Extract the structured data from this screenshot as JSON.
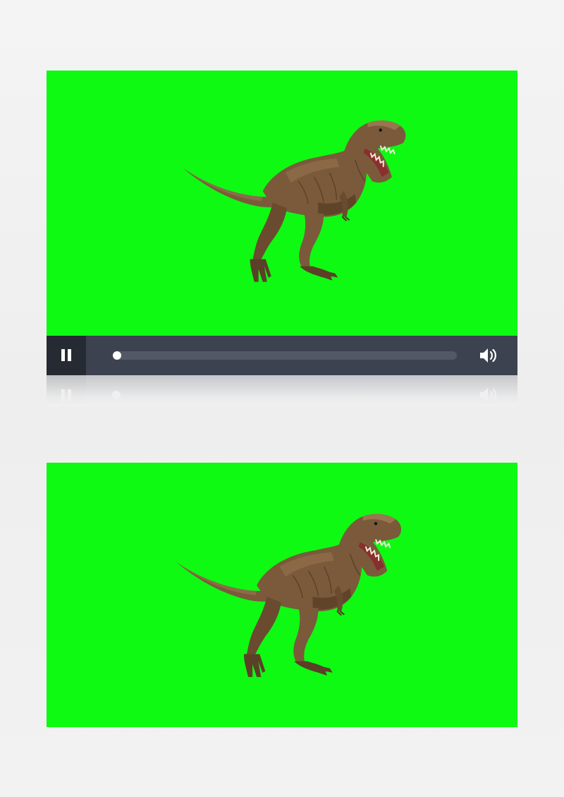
{
  "colors": {
    "green_screen": "#0efa12",
    "control_bar": "#3d4250",
    "control_bar_dark": "#262a33",
    "progress_track": "#535866",
    "handle": "#ffffff",
    "dino_body": "#7a5a3a",
    "dino_shadow": "#4e3620",
    "dino_highlight": "#9a7650"
  },
  "player": {
    "video": {
      "subject": "t-rex-dinosaur",
      "background": "green-screen"
    },
    "controls": {
      "state": "playing",
      "play_pause_icon": "pause-icon",
      "progress_fraction": 0.0,
      "volume_icon": "volume-icon"
    }
  },
  "preview": {
    "subject": "t-rex-dinosaur",
    "background": "green-screen"
  }
}
